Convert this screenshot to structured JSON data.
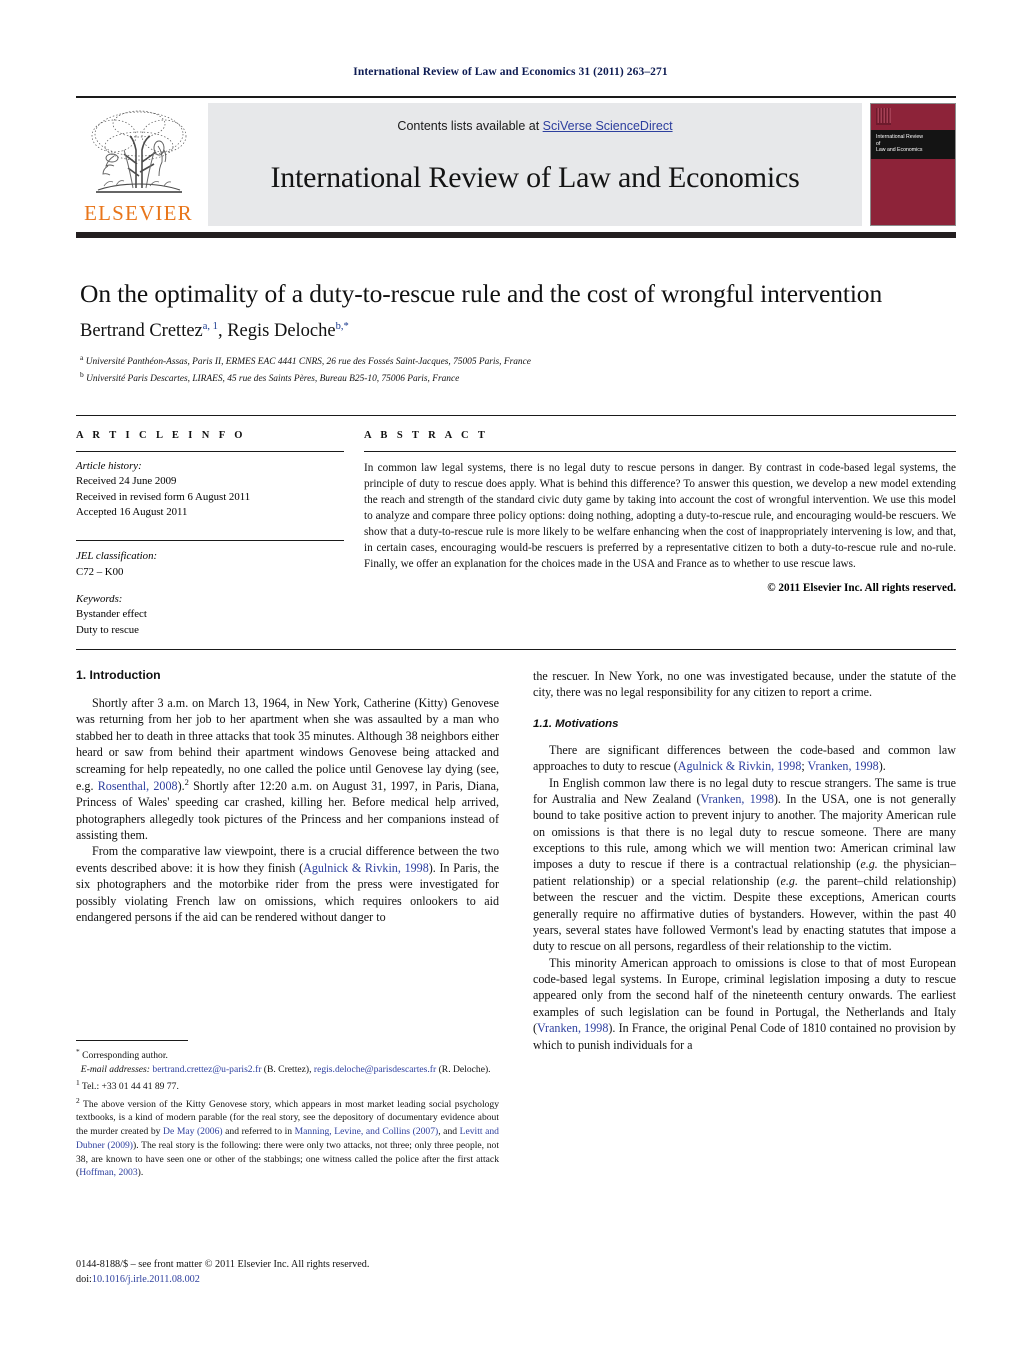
{
  "running_head": "International Review of Law and Economics 31 (2011) 263–271",
  "masthead": {
    "contents_prefix": "Contents lists available at ",
    "sciencedirect_link": "SciVerse ScienceDirect",
    "journal_title": "International Review of Law and Economics",
    "publisher_word": "ELSEVIER",
    "cover_line1": "International Review",
    "cover_line2": "of",
    "cover_line3": "Law and Economics",
    "link_color": "#2d3f9e",
    "cover_color": "#8d2339",
    "elsevier_orange": "#e8751a"
  },
  "title_block": {
    "title": "On the optimality of a duty-to-rescue rule and the cost of wrongful intervention",
    "author1": "Bertrand Crettez",
    "author1_sup": "a, 1",
    "author_sep": ", ",
    "author2": "Regis Deloche",
    "author2_sup": "b,*",
    "affiliation_a_sup": "a",
    "affiliation_a": "Université Panthéon-Assas, Paris II, ERMES EAC 4441 CNRS, 26 rue des Fossés Saint-Jacques, 75005 Paris, France",
    "affiliation_b_sup": "b",
    "affiliation_b": "Université Paris Descartes, LIRAES, 45 rue des Saints Pères, Bureau B25-10, 75006 Paris, France"
  },
  "article_info": {
    "heading": "A R T I C L E   I N F O",
    "history_label": "Article history:",
    "history": [
      "Received 24 June 2009",
      "Received in revised form 6 August 2011",
      "Accepted 16 August 2011"
    ],
    "jel_label": "JEL classification:",
    "jel_value": "C72 – K00",
    "keywords_label": "Keywords:",
    "keywords": [
      "Bystander effect",
      "Duty to rescue"
    ]
  },
  "abstract": {
    "heading": "A B S T R A C T",
    "text": "In common law legal systems, there is no legal duty to rescue persons in danger. By contrast in code-based legal systems, the principle of duty to rescue does apply. What is behind this difference? To answer this question, we develop a new model extending the reach and strength of the standard civic duty game by taking into account the cost of wrongful intervention. We use this model to analyze and compare three policy options: doing nothing, adopting a duty-to-rescue rule, and encouraging would-be rescuers. We show that a duty-to-rescue rule is more likely to be welfare enhancing when the cost of inappropriately intervening is low, and that, in certain cases, encouraging would-be rescuers is preferred by a representative citizen to both a duty-to-rescue rule and no-rule. Finally, we offer an explanation for the choices made in the USA and France as to whether to use rescue laws.",
    "copyright": "© 2011 Elsevier Inc. All rights reserved."
  },
  "body": {
    "section1_heading": "1. Introduction",
    "left_p1_a": "Shortly after 3 a.m. on March 13, 1964, in New York, Catherine (Kitty) Genovese was returning from her job to her apartment when she was assaulted by a man who stabbed her to death in three attacks that took 35 minutes. Although 38 neighbors either heard or saw from behind their apartment windows Genovese being attacked and screaming for help repeatedly, no one called the police until Genovese lay dying (see, e.g. ",
    "left_p1_cite1": "Rosenthal, 2008",
    "left_p1_b": ").",
    "left_p1_fnmark": "2",
    "left_p1_c": " Shortly after 12:20 a.m. on August 31, 1997, in Paris, Diana, Princess of Wales' speeding car crashed, killing her. Before medical help arrived, photographers allegedly took pictures of the Princess and her companions instead of assisting them.",
    "left_p2_a": "From the comparative law viewpoint, there is a crucial difference between the two events described above: it is how they finish (",
    "left_p2_cite": "Agulnick & Rivkin, 1998",
    "left_p2_b": "). In Paris, the six photographers and the motorbike rider from the press were investigated for possibly violating French law on omissions, which requires onlookers to aid endangered persons if the aid can be rendered without danger to",
    "right_p1": "the rescuer. In New York, no one was investigated because, under the statute of the city, there was no legal responsibility for any citizen to report a crime.",
    "subsection_heading": "1.1. Motivations",
    "right_p2_a": "There are significant differences between the code-based and common law approaches to duty to rescue (",
    "right_p2_cite1": "Agulnick & Rivkin, 1998",
    "right_p2_sep": "; ",
    "right_p2_cite2": "Vranken, 1998",
    "right_p2_b": ").",
    "right_p3_a": "In English common law there is no legal duty to rescue strangers. The same is true for Australia and New Zealand (",
    "right_p3_cite": "Vranken, 1998",
    "right_p3_b": "). In the USA, one is not generally bound to take positive action to prevent injury to another. The majority American rule on omissions is that there is no legal duty to rescue someone. There are many exceptions to this rule, among which we will mention two: American criminal law imposes a duty to rescue if there is a contractual relationship (",
    "right_p3_it1": "e.g.",
    "right_p3_c": " the physician–patient relationship) or a special relationship (",
    "right_p3_it2": "e.g.",
    "right_p3_d": " the parent–child relationship) between the rescuer and the victim. Despite these exceptions, American courts generally require no affirmative duties of bystanders. However, within the past 40 years, several states have followed Vermont's lead by enacting statutes that impose a duty to rescue on all persons, regardless of their relationship to the victim.",
    "right_p4_a": "This minority American approach to omissions is close to that of most European code-based legal systems. In Europe, criminal legislation imposing a duty to rescue appeared only from the second half of the nineteenth century onwards. The earliest examples of such legislation can be found in Portugal, the Netherlands and Italy (",
    "right_p4_cite": "Vranken, 1998",
    "right_p4_b": "). In France, the original Penal Code of 1810 contained no provision by which to punish individuals for a"
  },
  "footnotes": {
    "star_mark": "*",
    "corresponding": " Corresponding author.",
    "email_label": "E-mail addresses:",
    "email1": "bertrand.crettez@u-paris2.fr",
    "email1_owner": " (B. Crettez),",
    "email2": "regis.deloche@parisdescartes.fr",
    "email2_owner": " (R. Deloche).",
    "fn1_mark": "1",
    "fn1_text": " Tel.: +33 01 44 41 89 77.",
    "fn2_mark": "2",
    "fn2_a": " The above version of the Kitty Genovese story, which appears in most market leading social psychology textbooks, is a kind of modern parable (for the real story, see the depository of documentary evidence about the murder created by ",
    "fn2_cite1": "De May (2006)",
    "fn2_b": " and referred to in ",
    "fn2_cite2": "Manning, Levine, and Collins (2007)",
    "fn2_c": ", and ",
    "fn2_cite3": "Levitt and Dubner (2009)",
    "fn2_d": "). The real story is the following: there were only two attacks, not three; only three people, not 38, are known to have seen one or other of the stabbings; one witness called the police after the first attack (",
    "fn2_cite4": "Hoffman, 2003",
    "fn2_e": ")."
  },
  "issn_line": {
    "text": "0144-8188/$ – see front matter © 2011 Elsevier Inc. All rights reserved.",
    "doi_prefix": "doi:",
    "doi": "10.1016/j.irle.2011.08.002"
  }
}
